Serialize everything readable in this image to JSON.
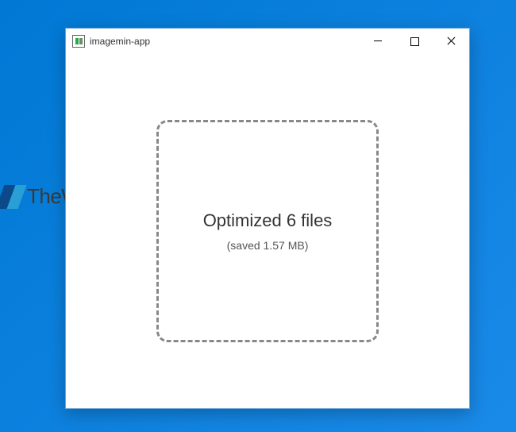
{
  "watermark": {
    "text": "TheWindowsClub"
  },
  "window": {
    "title": "imagemin-app"
  },
  "dropzone": {
    "status": "Optimized 6 files",
    "saved": "(saved 1.57 MB)"
  }
}
